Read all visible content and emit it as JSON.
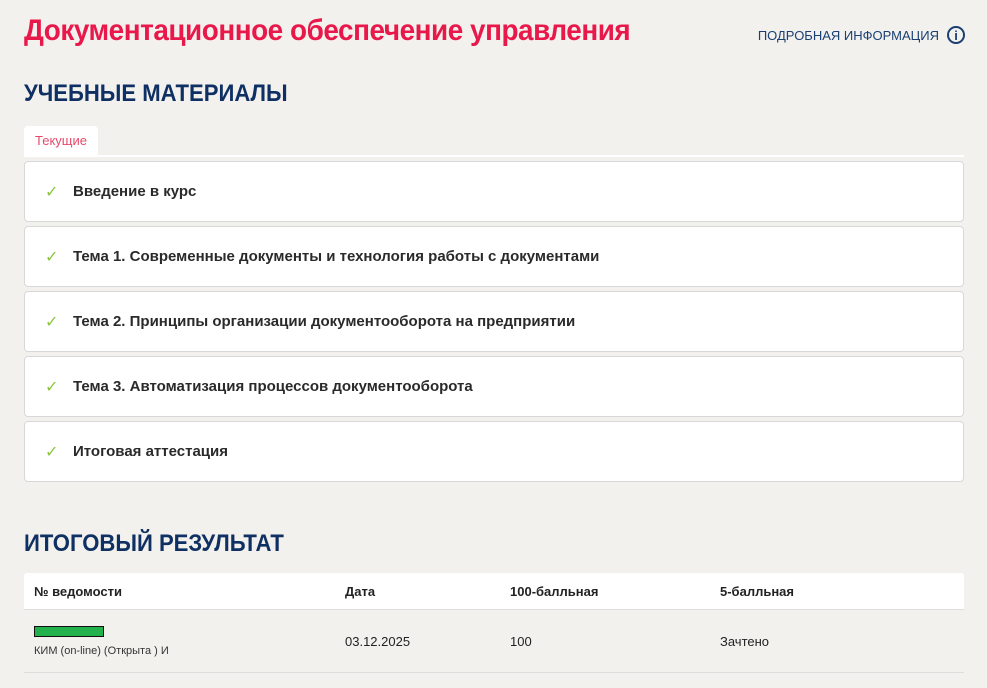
{
  "header": {
    "title": "Документационное обеспечение управления",
    "info_link": "ПОДРОБНАЯ ИНФОРМАЦИЯ",
    "info_icon": "i"
  },
  "materials": {
    "heading": "УЧЕБНЫЕ МАТЕРИАЛЫ",
    "tab": "Текущие",
    "items": [
      {
        "label": "Введение в курс"
      },
      {
        "label": "Тема 1. Современные документы и технология работы с документами"
      },
      {
        "label": "Тема 2. Принципы организации документооборота на предприятии"
      },
      {
        "label": "Тема 3. Автоматизация процессов документооборота"
      },
      {
        "label": "Итоговая аттестация"
      }
    ]
  },
  "result": {
    "heading": "ИТОГОВЫЙ РЕЗУЛЬТАТ",
    "columns": [
      "№ ведомости",
      "Дата",
      "100-балльная",
      "5-балльная"
    ],
    "rows": [
      {
        "progress": 100,
        "statement": "КИМ (on-line) (Открыта ) И",
        "date": "03.12.2025",
        "score100": "100",
        "score5": "Зачтено"
      }
    ]
  },
  "colors": {
    "accent": "#e8194a",
    "heading": "#0f3063",
    "check": "#8cc63f",
    "progress": "#22b14c"
  }
}
